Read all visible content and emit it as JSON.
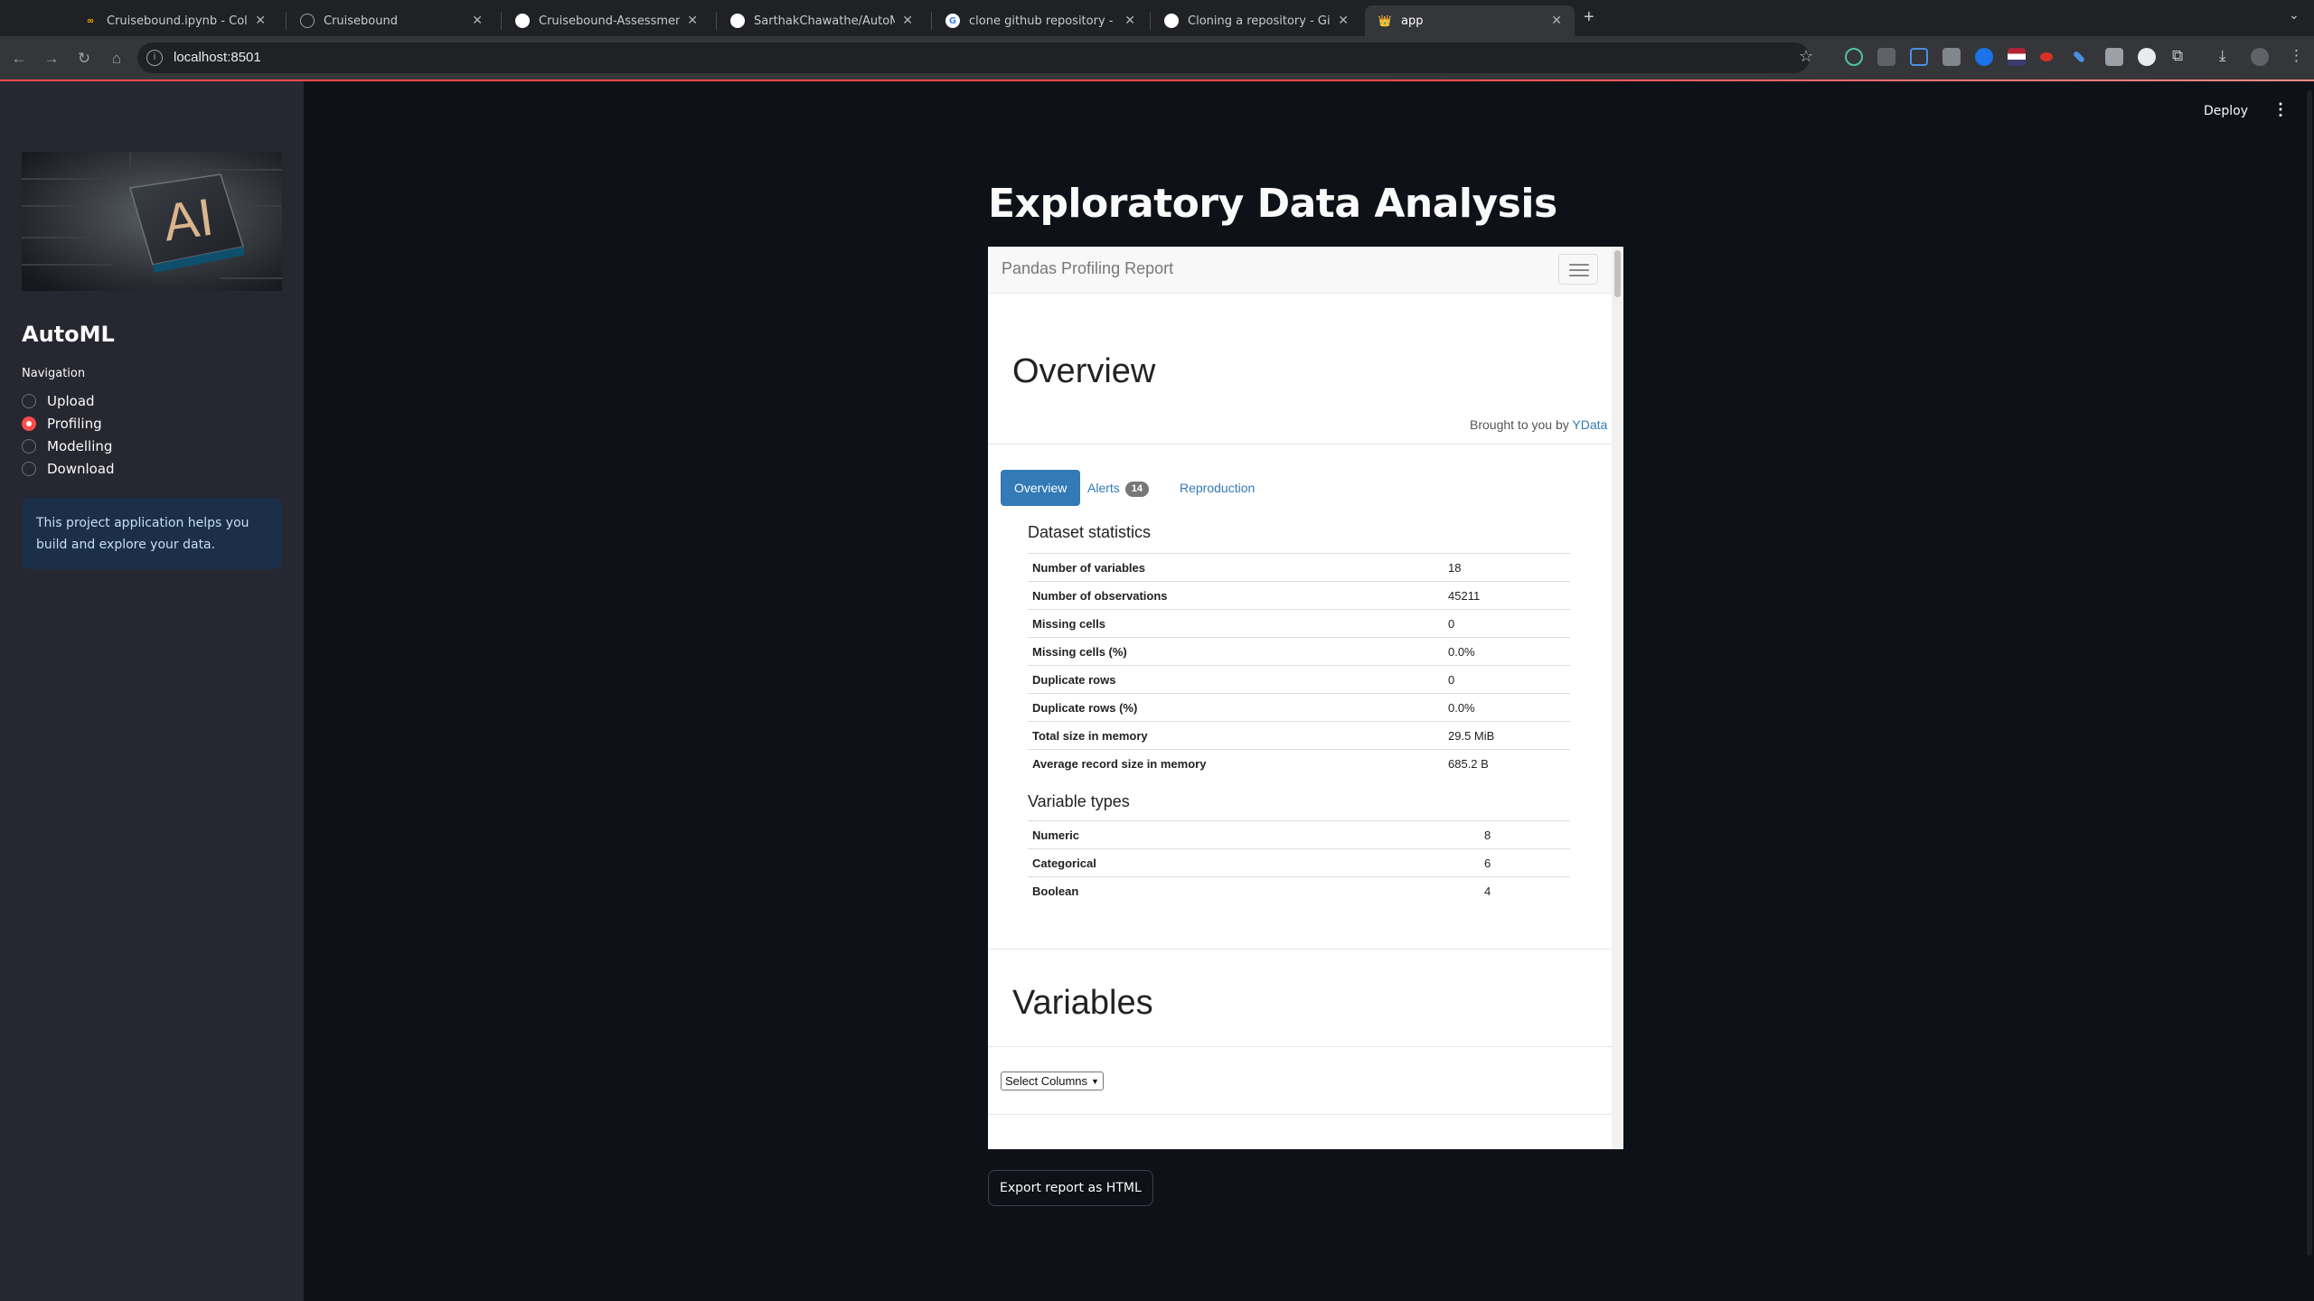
{
  "browser": {
    "tabs": [
      {
        "label": "Cruisebound.ipynb - Colab",
        "icon": "colab-icon",
        "icon_color": "#f9ab00"
      },
      {
        "label": "Cruisebound",
        "icon": "globe-icon",
        "icon_color": "#9aa0a6"
      },
      {
        "label": "Cruisebound-Assessment/Pa",
        "icon": "github-icon",
        "icon_color": "#ffffff"
      },
      {
        "label": "SarthakChawathe/AutoML",
        "icon": "github-icon",
        "icon_color": "#ffffff"
      },
      {
        "label": "clone github repository - Goo",
        "icon": "google-icon",
        "icon_color": "#4285f4"
      },
      {
        "label": "Cloning a repository - GitHub",
        "icon": "github-icon",
        "icon_color": "#ffffff"
      },
      {
        "label": "app",
        "icon": "streamlit-icon",
        "icon_color": "#ff4b4b"
      }
    ],
    "url": "localhost:8501"
  },
  "sidebar": {
    "image_text": "AI",
    "title": "AutoML",
    "nav_label": "Navigation",
    "options": [
      "Upload",
      "Profiling",
      "Modelling",
      "Download"
    ],
    "selected": "Profiling",
    "info": "This project application helps you build and explore your data."
  },
  "header": {
    "deploy_label": "Deploy",
    "menu_icon": "more-vertical-icon"
  },
  "main": {
    "title": "Exploratory Data Analysis",
    "export_label": "Export report as HTML"
  },
  "report": {
    "brand": "Pandas Profiling Report",
    "overview_heading": "Overview",
    "brought_prefix": "Brought to you by",
    "brought_link": "YData",
    "tabs": [
      {
        "label": "Overview",
        "active": true
      },
      {
        "label": "Alerts",
        "badge": "14"
      },
      {
        "label": "Reproduction"
      }
    ],
    "dataset_statistics": {
      "heading": "Dataset statistics",
      "rows": [
        {
          "k": "Number of variables",
          "v": "18"
        },
        {
          "k": "Number of observations",
          "v": "45211"
        },
        {
          "k": "Missing cells",
          "v": "0"
        },
        {
          "k": "Missing cells (%)",
          "v": "0.0%"
        },
        {
          "k": "Duplicate rows",
          "v": "0"
        },
        {
          "k": "Duplicate rows (%)",
          "v": "0.0%"
        },
        {
          "k": "Total size in memory",
          "v": "29.5 MiB"
        },
        {
          "k": "Average record size in memory",
          "v": "685.2 B"
        }
      ]
    },
    "variable_types": {
      "heading": "Variable types",
      "rows": [
        {
          "k": "Numeric",
          "v": "8"
        },
        {
          "k": "Categorical",
          "v": "6"
        },
        {
          "k": "Boolean",
          "v": "4"
        }
      ]
    },
    "variables_heading": "Variables",
    "select_label": "Select Columns"
  },
  "colors": {
    "accent": "#ff4b4b",
    "link": "#337ab7",
    "app_bg": "#0e1117",
    "sidebar_bg": "#262730"
  }
}
